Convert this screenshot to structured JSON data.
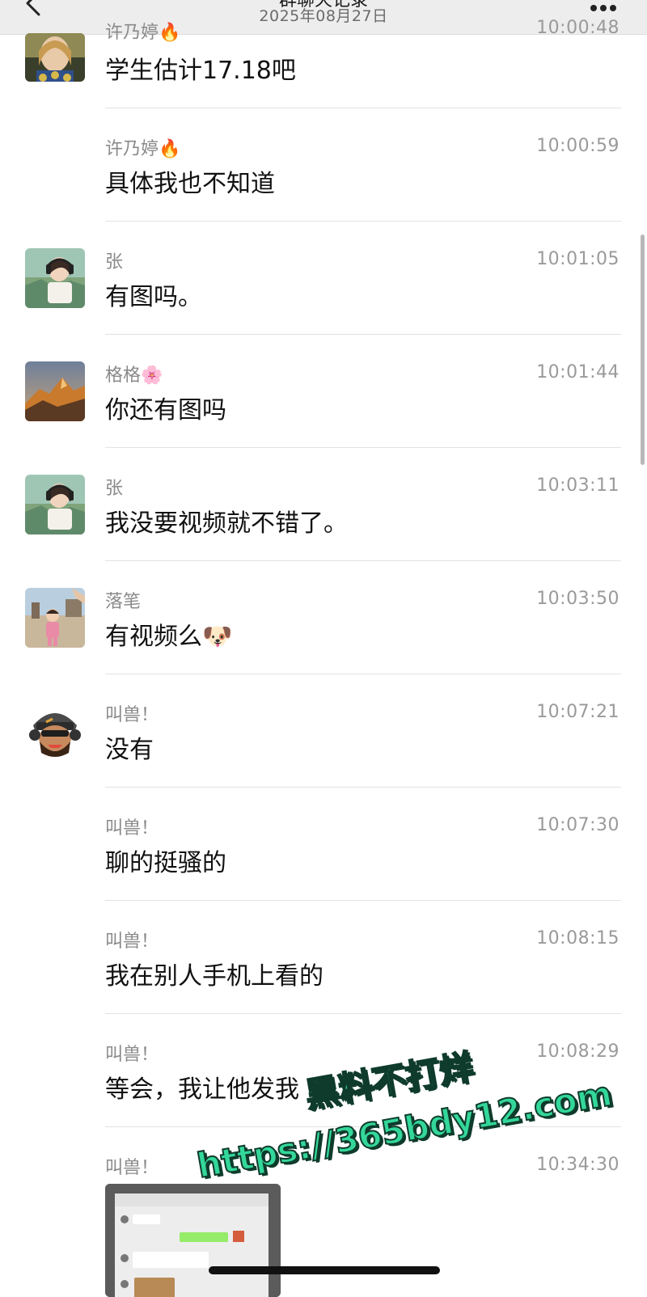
{
  "header": {
    "title": "群聊天记录",
    "date": "2025年08月27日"
  },
  "messages": [
    {
      "sender": "许乃婷🔥",
      "time": "10:00:48",
      "text": "学生估计17.18吧",
      "avatar": "portrait-woman-avatar"
    },
    {
      "sender": "许乃婷🔥",
      "time": "10:00:59",
      "text": "具体我也不知道",
      "avatar": ""
    },
    {
      "sender": "张",
      "time": "10:01:05",
      "text": "有图吗。",
      "avatar": "anime-girl-headphones-avatar"
    },
    {
      "sender": "格格🌸",
      "time": "10:01:44",
      "text": "你还有图吗",
      "avatar": "mountain-sunset-avatar"
    },
    {
      "sender": "张",
      "time": "10:03:11",
      "text": "我没要视频就不错了。",
      "avatar": "anime-girl-headphones-avatar"
    },
    {
      "sender": "落笔",
      "time": "10:03:50",
      "text": "有视频么🐶",
      "avatar": "child-photo-avatar"
    },
    {
      "sender": "叫兽！",
      "time": "10:07:21",
      "text": "没有",
      "avatar": "cartoon-soldier-avatar"
    },
    {
      "sender": "叫兽！",
      "time": "10:07:30",
      "text": "聊的挺骚的",
      "avatar": ""
    },
    {
      "sender": "叫兽！",
      "time": "10:08:15",
      "text": "我在别人手机上看的",
      "avatar": ""
    },
    {
      "sender": "叫兽！",
      "time": "10:08:29",
      "text": "等会，我让他发我",
      "avatar": ""
    },
    {
      "sender": "叫兽！",
      "time": "10:34:30",
      "text": "",
      "avatar": ""
    }
  ],
  "watermark": {
    "line1": "黑料不打烊",
    "line2": "https://365bdy12.com"
  },
  "colors": {
    "header_bg": "#ededed",
    "divider": "#e2e2e2",
    "watermark_fill": "#33d79a",
    "watermark_outline": "#0f3b2c"
  }
}
